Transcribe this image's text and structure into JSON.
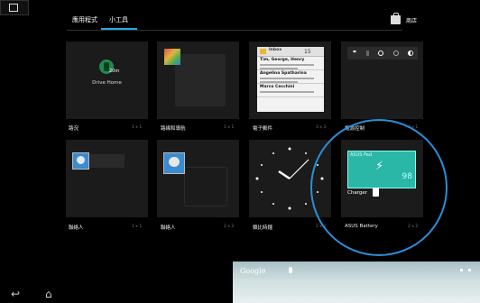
{
  "topbar": {
    "tabs": [
      {
        "label": "應用程式"
      },
      {
        "label": "小工具"
      }
    ],
    "store_label": "商店"
  },
  "cards": [
    {
      "label": "路況",
      "size": "1 x 1",
      "drive_text": "Drive Home",
      "drive_dist": "20m"
    },
    {
      "label": "路線和導航",
      "size": "1 x 1"
    },
    {
      "label": "電子郵件",
      "size": "3 x 3",
      "mail_title": "Inbox",
      "mail_count": "15",
      "mail_items": [
        "Tim, George, Henry",
        "Angelina Spatharina",
        "Marco Cecchini"
      ]
    },
    {
      "label": "電源控制",
      "size": "4 x 1"
    },
    {
      "label": "聯絡人",
      "size": "1 x 1"
    },
    {
      "label": "聯絡人",
      "size": "2 x 2"
    },
    {
      "label": "類比時鐘",
      "size": "2 x 2"
    },
    {
      "label": "ASUS Battery",
      "size": "2 x 2",
      "battery_name": "ASUS Pad",
      "battery_pct": "98",
      "charger": "Charger"
    }
  ],
  "wallpaper": {
    "google_text": "Google"
  },
  "colors": {
    "accent": "#2aa8e0",
    "highlight": "#2a8fd8"
  }
}
